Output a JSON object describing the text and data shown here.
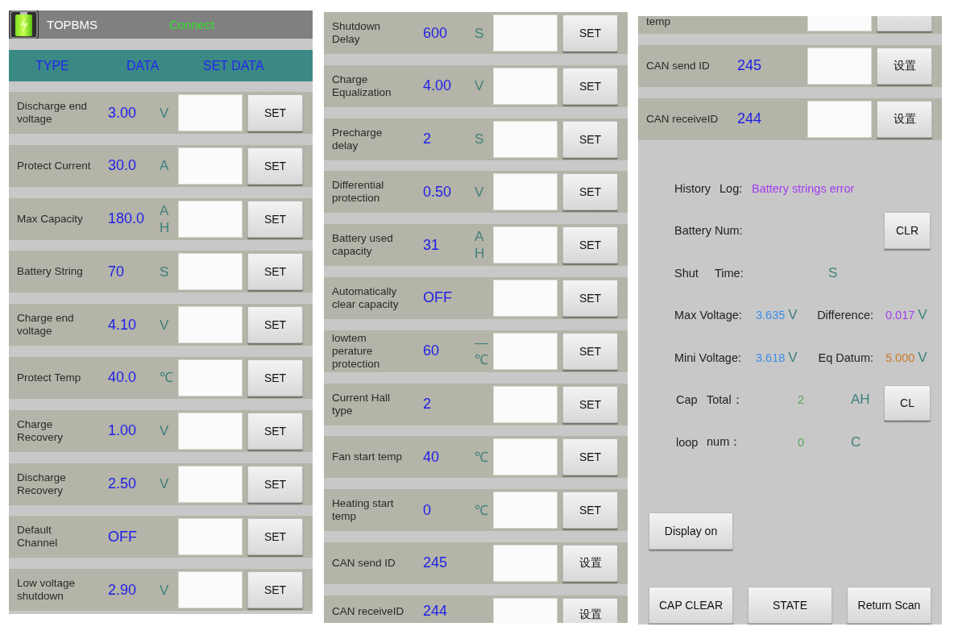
{
  "screens": [
    {
      "app_bar": {
        "title": "TOPBMS",
        "status": "Connect"
      },
      "table_header": {
        "columns": [
          "TYPE",
          "DATA",
          "SET DATA"
        ]
      },
      "rows": [
        {
          "kind": "full",
          "label": "Discharge end\nvoltage",
          "value": "3.00",
          "unit": "V",
          "button": "SET"
        },
        {
          "kind": "full",
          "label": "Protect Current",
          "value": "30.0",
          "unit": "A",
          "button": "SET"
        },
        {
          "kind": "full",
          "label": "Max Capacity",
          "value": "180.0",
          "unit": "AH",
          "button": "SET"
        },
        {
          "kind": "full",
          "label": "Battery String",
          "value": "70",
          "unit": "S",
          "button": "SET"
        },
        {
          "kind": "full",
          "label": "Charge end\nvoltage",
          "value": "4.10",
          "unit": "V",
          "button": "SET"
        },
        {
          "kind": "full",
          "label": "Protect Temp",
          "value": "40.0",
          "unit": "℃",
          "button": "SET"
        },
        {
          "kind": "full",
          "label": "Charge\nRecovery",
          "value": "1.00",
          "unit": "V",
          "button": "SET"
        },
        {
          "kind": "full",
          "label": "Discharge\nRecovery",
          "value": "2.50",
          "unit": "V",
          "button": "SET"
        },
        {
          "kind": "full",
          "label": "Default\nChannel",
          "value": "OFF",
          "button": "SET"
        },
        {
          "kind": "full",
          "label": "Low voltage\nshutdown",
          "value": "2.90",
          "unit": "V",
          "button": "SET"
        }
      ]
    },
    {
      "rows": [
        {
          "kind": "full",
          "label": "Shutdown\nDelay",
          "value": "600",
          "unit": "S",
          "button": "SET"
        },
        {
          "kind": "full",
          "label": "Charge\nEqualization",
          "value": "4.00",
          "unit": "V",
          "button": "SET"
        },
        {
          "kind": "full",
          "label": "Precharge\ndelay",
          "value": "2",
          "unit": "S",
          "button": "SET"
        },
        {
          "kind": "full",
          "label": "Differential\nprotection",
          "value": "0.50",
          "unit": "V",
          "button": "SET"
        },
        {
          "kind": "full",
          "label": "Battery used\ncapacity",
          "value": "31",
          "unit": "AH",
          "button": "SET"
        },
        {
          "kind": "full",
          "label": "Automatically\nclear capacity",
          "value": "OFF",
          "button": "SET"
        },
        {
          "kind": "full",
          "label": "lowtem\nperature\nprotection",
          "value": "60",
          "unit": "—℃",
          "button": "SET"
        },
        {
          "kind": "full",
          "label": "Current Hall\ntype",
          "value": "2",
          "button": "SET"
        },
        {
          "kind": "full",
          "label": "Fan start temp",
          "value": "40",
          "unit": "℃",
          "button": "SET"
        },
        {
          "kind": "full",
          "label": "Heating start\ntemp",
          "value": "0",
          "unit": "℃",
          "button": "SET"
        },
        {
          "kind": "full",
          "label": "CAN send ID",
          "value": "245",
          "button": "设置"
        },
        {
          "kind": "cut_bottom",
          "label": "CAN receiveID",
          "value": "244",
          "button": "设置"
        }
      ]
    },
    {
      "rows": [
        {
          "kind": "cut_top",
          "label": "temp"
        },
        {
          "kind": "full",
          "label": "CAN send ID",
          "value": "245",
          "button": "设置"
        },
        {
          "kind": "full",
          "label": "CAN receiveID",
          "value": "244",
          "button": "设置"
        }
      ],
      "status_panel": {
        "history": {
          "label": "History",
          "label_2": "Log:",
          "message": "Battery strings error"
        },
        "battery_num": {
          "label": "Battery Num:",
          "button": "CLR"
        },
        "shut_time": {
          "label": "Shut",
          "label_2": "Time:",
          "unit": "S"
        },
        "voltages": [
          {
            "label": "Max Voltage:",
            "value": "3.635",
            "unit": "V",
            "color": "#3b8ee8"
          },
          {
            "label": "Difference:",
            "value": "0.017",
            "unit": "V",
            "color": "#a43cf0"
          },
          {
            "label": "Mini Voltage:",
            "value": "3.618",
            "unit": "V",
            "color": "#3b8ee8"
          },
          {
            "label": "Eq Datum:",
            "value": "5.000",
            "unit": "V",
            "color": "#c97a2c"
          }
        ],
        "counters": [
          {
            "label": "Cap",
            "label_2": "Total：",
            "value": "2",
            "unit": "AH",
            "button": "CL"
          },
          {
            "label": "loop",
            "label_2": "num：",
            "value": "0",
            "unit": "C"
          }
        ],
        "display_button": "Display on",
        "bottom_buttons": [
          "CAP CLEAR",
          "STATE",
          "Return Scan"
        ]
      }
    }
  ]
}
